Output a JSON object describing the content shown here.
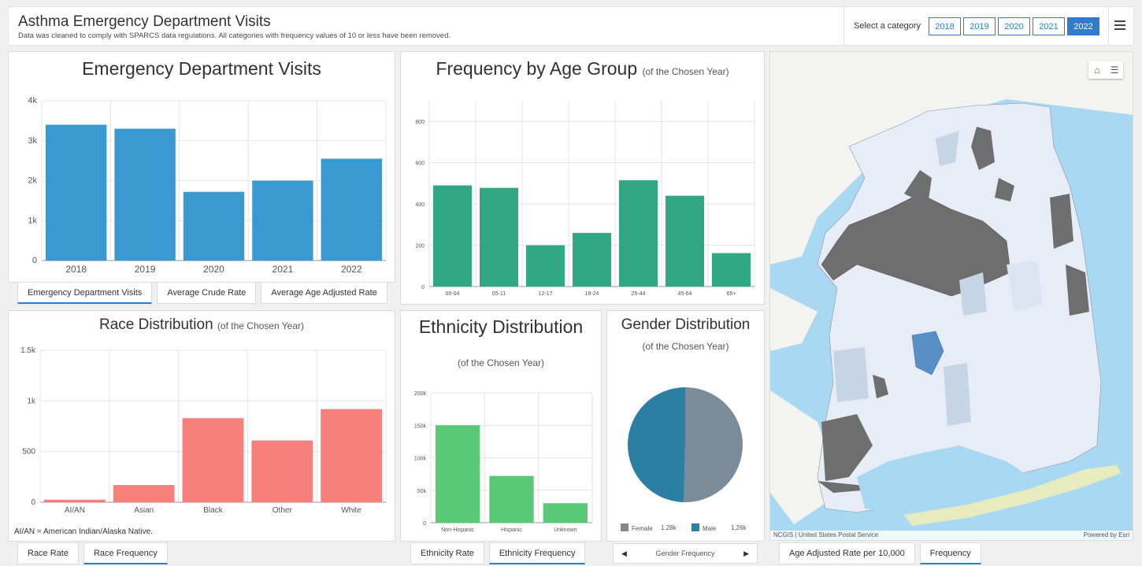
{
  "header": {
    "title": "Asthma Emergency Department Visits",
    "subtitle": "Data was cleaned to comply with SPARCS data regulations.  All categories with frequency values of 10 or less have been removed.",
    "select_label": "Select a category",
    "years": [
      "2018",
      "2019",
      "2020",
      "2021",
      "2022"
    ],
    "active_year": "2022"
  },
  "ed_panel": {
    "title": "Emergency Department Visits",
    "tabs": [
      "Emergency Department Visits",
      "Average Crude Rate",
      "Average Age Adjusted Rate"
    ],
    "active_tab": "Emergency Department Visits"
  },
  "age_panel": {
    "title": "Frequency by Age Group",
    "subtitle": "(of the Chosen Year)"
  },
  "race_panel": {
    "title": "Race Distribution",
    "subtitle": "(of the Chosen Year)",
    "footnote": "AI/AN = American Indian/Alaska Native.",
    "tabs": [
      "Race Rate",
      "Race Frequency"
    ],
    "active_tab": "Race Frequency"
  },
  "ethnicity_panel": {
    "title": "Ethnicity Distribution",
    "subtitle": "(of the Chosen Year)",
    "tabs": [
      "Ethnicity Rate",
      "Ethnicity Frequency"
    ],
    "active_tab": "Ethnicity Frequency"
  },
  "gender_panel": {
    "title": "Gender Distribution",
    "subtitle": "(of the Chosen Year)",
    "nav_label": "Gender Frequency",
    "legend": [
      {
        "label": "Female",
        "value": "1.28k",
        "color": "#7a8b99"
      },
      {
        "label": "Male",
        "value": "1.26k",
        "color": "#2b7fa3"
      }
    ]
  },
  "map_panel": {
    "attribution": "NCGIS | United States Postal Service",
    "powered_by": "Powered by Esri",
    "tabs": [
      "Age Adjusted Rate per 10,000",
      "Frequency"
    ],
    "active_tab": "Frequency"
  },
  "chart_data": [
    {
      "type": "bar",
      "id": "ed_visits",
      "categories": [
        "2018",
        "2019",
        "2020",
        "2021",
        "2022"
      ],
      "values": [
        3400,
        3300,
        1720,
        2000,
        2550
      ],
      "yticks": [
        "0",
        "1k",
        "2k",
        "3k",
        "4k"
      ],
      "ylim": [
        0,
        4000
      ],
      "color": "#3b99d1"
    },
    {
      "type": "bar",
      "id": "age",
      "categories": [
        "00-04",
        "05-11",
        "12-17",
        "18-24",
        "25-44",
        "45-64",
        "65+"
      ],
      "values": [
        490,
        478,
        200,
        260,
        515,
        440,
        162
      ],
      "yticks": [
        "0",
        "200",
        "400",
        "600",
        "800"
      ],
      "ylim": [
        0,
        900
      ],
      "color": "#30a882"
    },
    {
      "type": "bar",
      "id": "race",
      "categories": [
        "AI/AN",
        "Asian",
        "Black",
        "Other",
        "White"
      ],
      "values": [
        25,
        170,
        830,
        610,
        920
      ],
      "yticks": [
        "0",
        "500",
        "1k",
        "1.5k"
      ],
      "ylim": [
        0,
        1500
      ],
      "color": "#f7807c"
    },
    {
      "type": "bar",
      "id": "ethnicity",
      "categories": [
        "Non-Hispanic",
        "Hispanic",
        "Unknown"
      ],
      "values": [
        150000,
        72000,
        30000
      ],
      "yticks": [
        "0",
        "50k",
        "100k",
        "150k",
        "200k"
      ],
      "ylim": [
        0,
        200000
      ],
      "color": "#5ac977"
    },
    {
      "type": "pie",
      "id": "gender",
      "categories": [
        "Female",
        "Male"
      ],
      "values": [
        1280,
        1260
      ],
      "colors": [
        "#7a8b99",
        "#2b7fa3"
      ]
    }
  ]
}
